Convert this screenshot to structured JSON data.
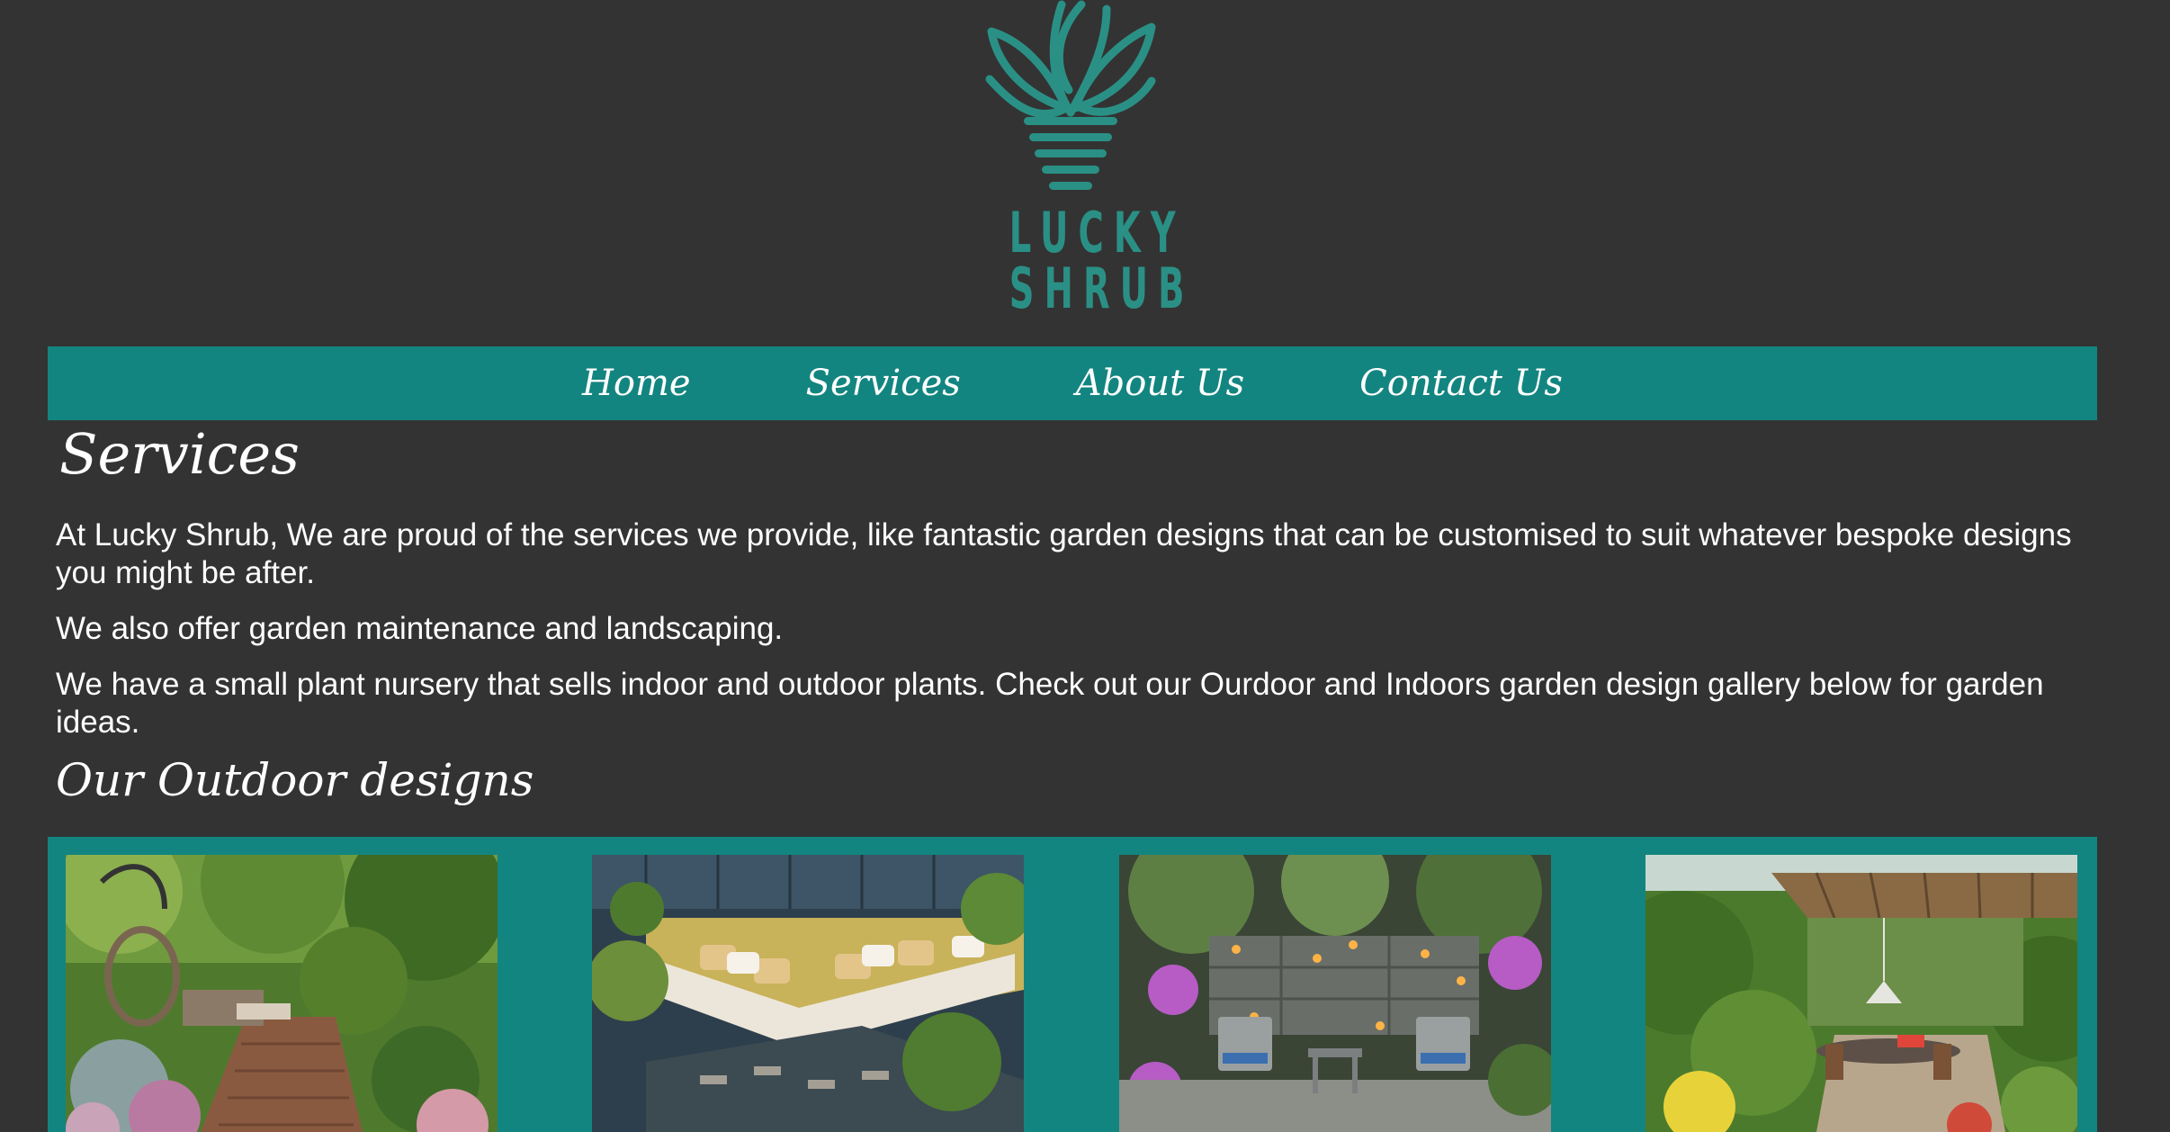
{
  "logo": {
    "line1": "LUCKY",
    "line2": "SHRUB",
    "icon": "potted-plant-icon",
    "color": "#2a9085"
  },
  "nav": {
    "items": [
      {
        "label": "Home"
      },
      {
        "label": "Services"
      },
      {
        "label": "About Us"
      },
      {
        "label": "Contact Us"
      }
    ],
    "background": "#138580"
  },
  "page": {
    "title": "Services",
    "paragraphs": [
      "At Lucky Shrub, We are proud of the services we provide, like fantastic garden designs that can be customised to suit whatever bespoke designs you might be after.",
      "We also offer garden maintenance and landscaping.",
      "We have a small plant nursery that sells indoor and outdoor plants. Check out our Ourdoor and Indoors garden design gallery below for garden ideas."
    ]
  },
  "outdoor": {
    "title": "Our Outdoor designs",
    "images": [
      {
        "name": "garden-deck-photo"
      },
      {
        "name": "patio-sofa-photo"
      },
      {
        "name": "rock-garden-photo"
      },
      {
        "name": "pergola-dining-photo"
      }
    ]
  },
  "colors": {
    "background": "#333333",
    "accent": "#138580"
  }
}
